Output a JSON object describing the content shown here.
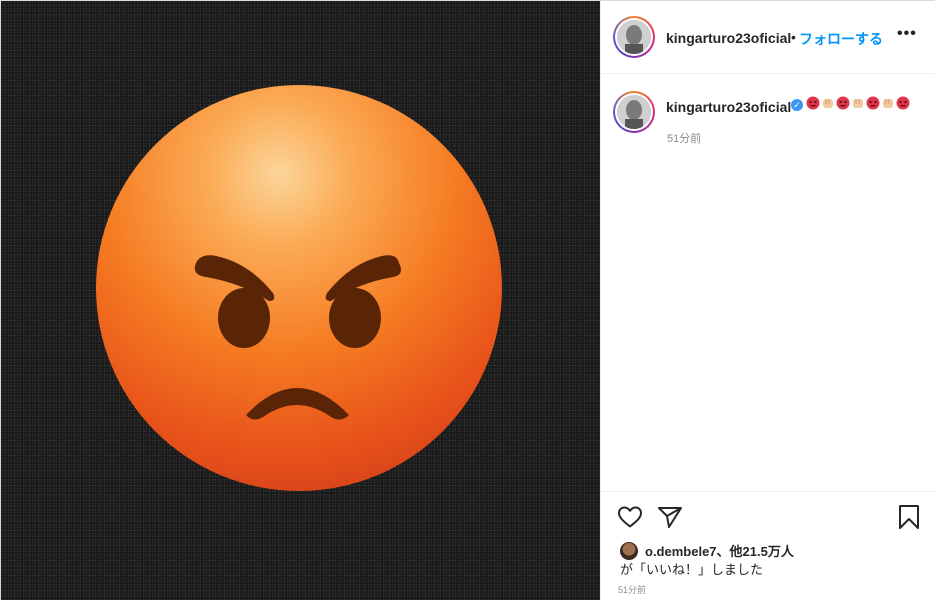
{
  "post": {
    "username": "kingarturo23oficial",
    "separator": "•",
    "follow_label": "フォローする",
    "more_label": "•••",
    "caption_emojis": [
      "angry-face",
      "fist",
      "angry-face",
      "fist",
      "angry-face",
      "fist",
      "angry-face"
    ],
    "caption_time": "51分前",
    "footer_time": "51分前"
  },
  "likes": {
    "liker": "o.dembele7",
    "others_text": "、他21.5万人",
    "suffix": "が「いいね！」しました"
  },
  "colors": {
    "link_blue": "#0095f6",
    "verified_blue": "#3897f0",
    "media_bg": "#141414",
    "emoji_orange": "#f57b22"
  },
  "icons": {
    "like": "heart-outline-icon",
    "share": "paper-plane-icon",
    "save": "bookmark-outline-icon",
    "more": "more-options-icon",
    "verified": "verified-badge-icon"
  }
}
